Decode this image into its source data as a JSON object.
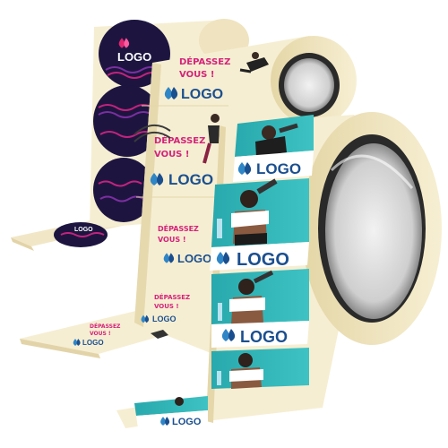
{
  "product": {
    "logo_text": "LOGO",
    "slogan_line1": "DÉPASSEZ",
    "slogan_line2": "VOUS !"
  },
  "colors": {
    "background": "#ffffff",
    "paper": "#f6eed2",
    "paper_shadow": "#e8dcb6",
    "navy_circle": "#1d1540",
    "teal": "#2db3b6",
    "magenta": "#d4237a",
    "logo_blue": "#1a4f8f",
    "core_dark": "#232323",
    "core_inner": "#d9d9d9"
  },
  "icons": [
    "droplet-logo-icon",
    "athlete-photo",
    "runner-illustration"
  ]
}
